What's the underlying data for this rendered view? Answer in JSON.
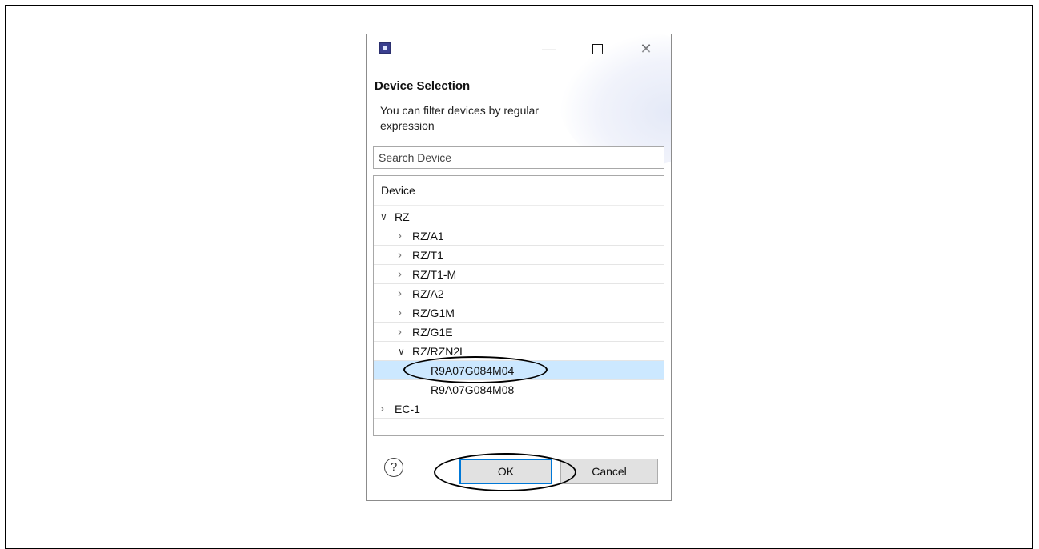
{
  "dialog": {
    "minimize_glyph": "—",
    "maximize_glyph": "",
    "close_glyph": "✕",
    "title": "Device Selection",
    "description": "You can filter devices by regular expression"
  },
  "search": {
    "placeholder": "Search Device",
    "value": ""
  },
  "tree": {
    "header": "Device",
    "items": [
      {
        "label": "RZ",
        "expanded": true,
        "level": 0
      },
      {
        "label": "RZ/A1",
        "expanded": false,
        "level": 1
      },
      {
        "label": "RZ/T1",
        "expanded": false,
        "level": 1
      },
      {
        "label": "RZ/T1-M",
        "expanded": false,
        "level": 1
      },
      {
        "label": "RZ/A2",
        "expanded": false,
        "level": 1
      },
      {
        "label": "RZ/G1M",
        "expanded": false,
        "level": 1
      },
      {
        "label": "RZ/G1E",
        "expanded": false,
        "level": 1
      },
      {
        "label": "RZ/RZN2L",
        "expanded": true,
        "level": 1
      },
      {
        "label": "R9A07G084M04",
        "level": 2,
        "selected": true
      },
      {
        "label": "R9A07G084M08",
        "level": 2,
        "selected": false
      },
      {
        "label": "EC-1",
        "expanded": false,
        "level": 0
      }
    ]
  },
  "buttons": {
    "help": "?",
    "ok": "OK",
    "cancel": "Cancel"
  },
  "colors": {
    "selection": "#cce8ff",
    "focus_border": "#0078d7",
    "button_bg": "#e1e1e1"
  }
}
